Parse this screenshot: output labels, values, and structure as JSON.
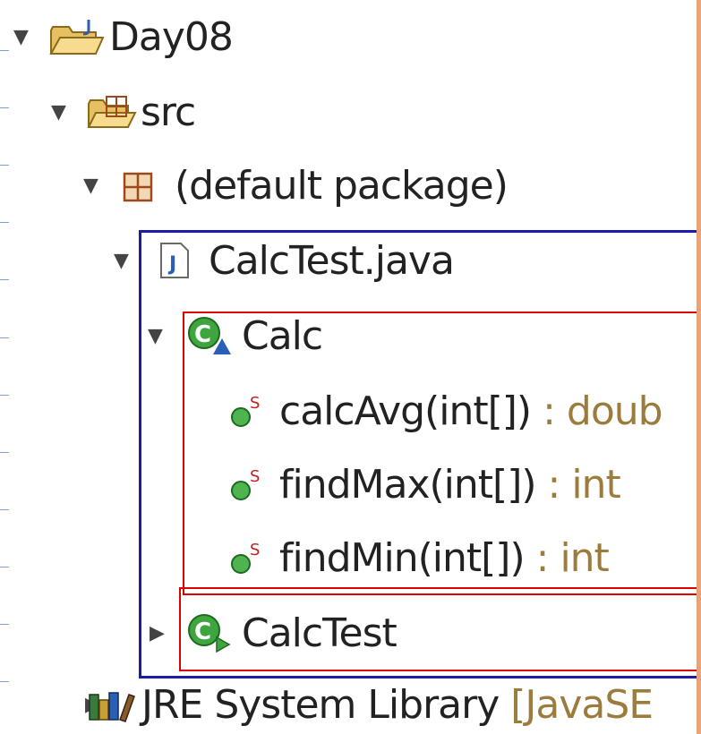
{
  "tree": {
    "project": {
      "label": "Day08"
    },
    "src": {
      "label": "src"
    },
    "package": {
      "label": "(default package)"
    },
    "file": {
      "label": "CalcTest.java"
    },
    "class_calc": {
      "label": "Calc"
    },
    "methods": [
      {
        "name": "calcAvg(int[])",
        "sig": " : doub"
      },
      {
        "name": "findMax(int[])",
        "sig": " : int"
      },
      {
        "name": "findMin(int[])",
        "sig": " : int"
      }
    ],
    "class_calctest": {
      "label": "CalcTest"
    },
    "jre": {
      "label": "JRE System Library ",
      "sig": "[JavaSE"
    }
  },
  "icons": {
    "project": "project-folder-icon",
    "src": "source-folder-icon",
    "package": "package-icon",
    "file": "java-file-icon",
    "class": "class-icon",
    "method": "static-method-icon",
    "jre": "library-icon"
  },
  "colors": {
    "highlight_blue": "#1c1caa",
    "highlight_red": "#e00000",
    "signature": "#9c7c3c"
  }
}
